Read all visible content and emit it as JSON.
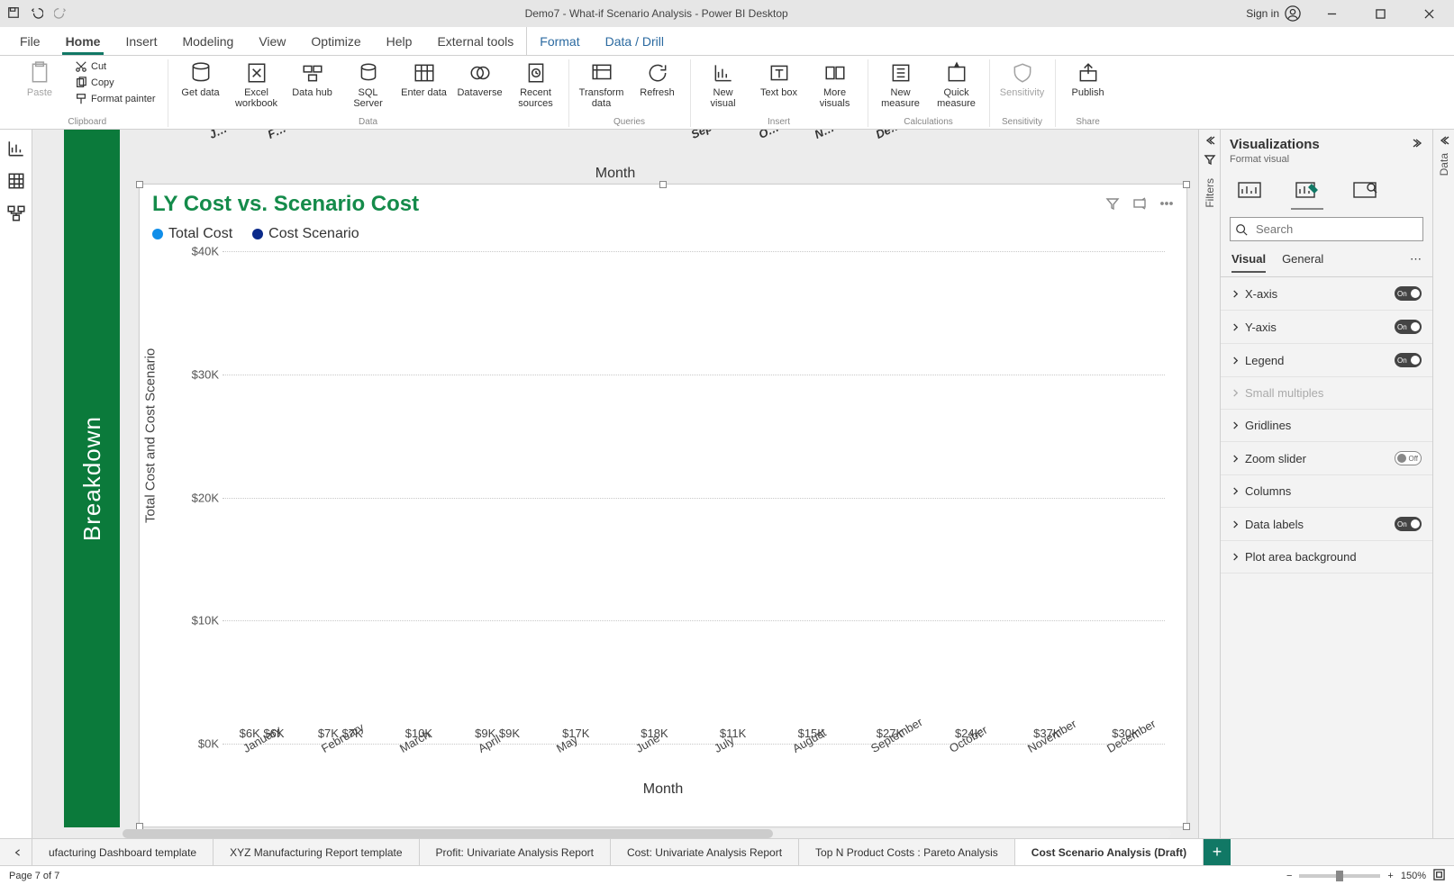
{
  "titlebar": {
    "title": "Demo7 - What-if Scenario Analysis - Power BI Desktop",
    "signin": "Sign in"
  },
  "menu": {
    "items": [
      "File",
      "Home",
      "Insert",
      "Modeling",
      "View",
      "Optimize",
      "Help",
      "External tools",
      "Format",
      "Data / Drill"
    ],
    "active": "Home"
  },
  "ribbon": {
    "clipboard": {
      "label": "Clipboard",
      "paste": "Paste",
      "cut": "Cut",
      "copy": "Copy",
      "format_painter": "Format painter"
    },
    "data": {
      "label": "Data",
      "get_data": "Get data",
      "excel": "Excel workbook",
      "datahub": "Data hub",
      "sql": "SQL Server",
      "enter": "Enter data",
      "dataverse": "Dataverse",
      "recent": "Recent sources"
    },
    "queries": {
      "label": "Queries",
      "transform": "Transform data",
      "refresh": "Refresh"
    },
    "insert": {
      "label": "Insert",
      "new_visual": "New visual",
      "textbox": "Text box",
      "more": "More visuals"
    },
    "calculations": {
      "label": "Calculations",
      "new_measure": "New measure",
      "quick_measure": "Quick measure"
    },
    "sensitivity": {
      "label": "Sensitivity",
      "btn": "Sensitivity"
    },
    "share": {
      "label": "Share",
      "publish": "Publish"
    }
  },
  "canvas": {
    "toplabel": "Month",
    "greenbar": "Breakdown",
    "partial_months": [
      "J",
      "F",
      "",
      "",
      "",
      "",
      "",
      "Sept",
      "",
      "N",
      "De"
    ]
  },
  "visual": {
    "title": "LY Cost vs. Scenario Cost",
    "legend": [
      {
        "label": "Total Cost",
        "color": "#108ee9"
      },
      {
        "label": "Cost Scenario",
        "color": "#0b2a8a"
      }
    ],
    "yaxis_label": "Total Cost and Cost Scenario",
    "xaxis_label": "Month"
  },
  "chart_data": {
    "type": "bar",
    "title": "LY Cost vs. Scenario Cost",
    "xlabel": "Month",
    "ylabel": "Total Cost and Cost Scenario",
    "ylim": [
      0,
      40000
    ],
    "yticks": [
      "$0K",
      "$10K",
      "$20K",
      "$30K",
      "$40K"
    ],
    "categories": [
      "January",
      "February",
      "March",
      "April",
      "May",
      "June",
      "July",
      "August",
      "September",
      "October",
      "November",
      "December"
    ],
    "series": [
      {
        "name": "Total Cost",
        "color": "#108ee9",
        "values": [
          6000,
          7000,
          10000,
          9000,
          17000,
          18000,
          11000,
          15000,
          27000,
          24000,
          37000,
          30000
        ]
      },
      {
        "name": "Cost Scenario",
        "color": "#0b2a8a",
        "values": [
          6000,
          7000,
          10000,
          9000,
          17000,
          18000,
          11000,
          15000,
          27000,
          24000,
          37000,
          30000
        ]
      }
    ],
    "data_labels": [
      [
        "$6K",
        "$6K"
      ],
      [
        "$7K",
        "$7K"
      ],
      [
        "$10K",
        ""
      ],
      [
        "$9K",
        "$9K"
      ],
      [
        "$17K",
        ""
      ],
      [
        "$18K",
        ""
      ],
      [
        "$11K",
        ""
      ],
      [
        "$15K",
        ""
      ],
      [
        "$27K",
        ""
      ],
      [
        "$24K",
        ""
      ],
      [
        "$37K",
        ""
      ],
      [
        "$30K",
        ""
      ]
    ]
  },
  "filters_label": "Filters",
  "viz_pane": {
    "title": "Visualizations",
    "subtitle": "Format visual",
    "search_placeholder": "Search",
    "tabs": [
      "Visual",
      "General"
    ],
    "active_tab": "Visual",
    "cards": [
      {
        "label": "X-axis",
        "toggle": "on"
      },
      {
        "label": "Y-axis",
        "toggle": "on"
      },
      {
        "label": "Legend",
        "toggle": "on"
      },
      {
        "label": "Small multiples",
        "disabled": true
      },
      {
        "label": "Gridlines"
      },
      {
        "label": "Zoom slider",
        "toggle": "off"
      },
      {
        "label": "Columns"
      },
      {
        "label": "Data labels",
        "toggle": "on"
      },
      {
        "label": "Plot area background"
      }
    ]
  },
  "data_tab": "Data",
  "pagetabs": {
    "items": [
      "ufacturing Dashboard template",
      "XYZ Manufacturing Report template",
      "Profit: Univariate Analysis Report",
      "Cost: Univariate Analysis Report",
      "Top N Product Costs : Pareto Analysis",
      "Cost Scenario Analysis (Draft)"
    ],
    "active": "Cost Scenario Analysis (Draft)"
  },
  "status": {
    "page": "Page 7 of 7",
    "zoom": "150%"
  }
}
